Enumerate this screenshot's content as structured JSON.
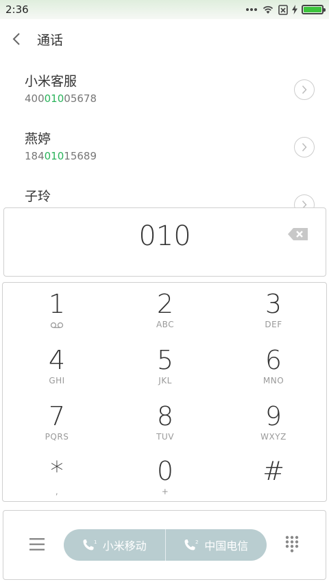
{
  "status": {
    "time": "2:36"
  },
  "header": {
    "title": "通话"
  },
  "contacts": [
    {
      "name": "小米客服",
      "num_pre": "400",
      "num_hl": "010",
      "num_post": "05678"
    },
    {
      "name": "燕婷",
      "num_pre": "184",
      "num_hl": "010",
      "num_post": "15689"
    },
    {
      "name": "子玲",
      "num_pre": "",
      "num_hl": "",
      "num_post": ""
    }
  ],
  "display": {
    "number": "010"
  },
  "keys": [
    {
      "digit": "1",
      "letters": ""
    },
    {
      "digit": "2",
      "letters": "ABC"
    },
    {
      "digit": "3",
      "letters": "DEF"
    },
    {
      "digit": "4",
      "letters": "GHI"
    },
    {
      "digit": "5",
      "letters": "JKL"
    },
    {
      "digit": "6",
      "letters": "MNO"
    },
    {
      "digit": "7",
      "letters": "PQRS"
    },
    {
      "digit": "8",
      "letters": "TUV"
    },
    {
      "digit": "9",
      "letters": "WXYZ"
    },
    {
      "digit": "*",
      "letters": ","
    },
    {
      "digit": "0",
      "letters": "+"
    },
    {
      "digit": "#",
      "letters": ""
    }
  ],
  "bottom": {
    "sim1_label": "小米移动",
    "sim1_index": "1",
    "sim2_label": "中国电信",
    "sim2_index": "2"
  },
  "colors": {
    "highlight": "#29b35a",
    "sim_button": "#b9cdd0",
    "battery": "#3cc43c"
  }
}
